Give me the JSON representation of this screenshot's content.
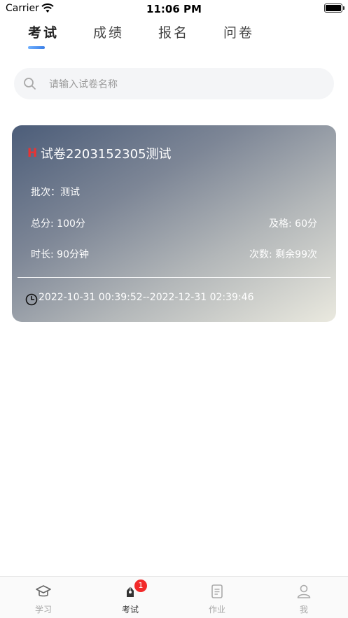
{
  "status_bar": {
    "carrier": "Carrier",
    "time": "11:06 PM"
  },
  "tabs": [
    {
      "label": "考试",
      "active": true
    },
    {
      "label": "成绩",
      "active": false
    },
    {
      "label": "报名",
      "active": false
    },
    {
      "label": "问卷",
      "active": false
    }
  ],
  "search": {
    "placeholder": "请输入试卷名称",
    "value": ""
  },
  "exam_card": {
    "badge": "H",
    "title": "试卷2203152305测试",
    "batch": "批次：测试",
    "total_score": "总分: 100分",
    "pass_score": "及格: 60分",
    "duration": "时长: 90分钟",
    "attempts": "次数: 剩余99次",
    "date_range": "2022-10-31 00:39:52--2022-12-31 02:39:46"
  },
  "bottom_nav": [
    {
      "label": "学习",
      "icon": "graduation-cap-icon",
      "active": false
    },
    {
      "label": "考试",
      "icon": "exam-pen-icon",
      "active": true,
      "badge": "1"
    },
    {
      "label": "作业",
      "icon": "document-icon",
      "active": false
    },
    {
      "label": "我",
      "icon": "user-icon",
      "active": false
    }
  ],
  "colors": {
    "tab_indicator": "#3a7ee6",
    "badge_red": "#f22a2a",
    "card_badge": "#e83333"
  }
}
